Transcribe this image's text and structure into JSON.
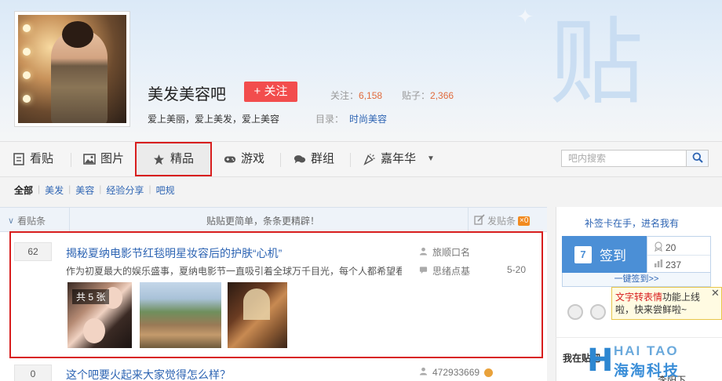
{
  "header": {
    "forum_name": "美发美容吧",
    "follow_label": "+ 关注",
    "stats": {
      "follow_label": "关注：",
      "follow_value": "6,158",
      "posts_label": "贴子：",
      "posts_value": "2,366"
    },
    "slogan": "爱上美丽，爱上美发，爱上美容",
    "directory_label": "目录：",
    "directory_value": "时尚美容"
  },
  "nav": {
    "items": [
      {
        "label": "看贴",
        "icon": "document-icon"
      },
      {
        "label": "图片",
        "icon": "image-icon"
      },
      {
        "label": "精品",
        "icon": "star-icon"
      },
      {
        "label": "游戏",
        "icon": "gamepad-icon"
      },
      {
        "label": "群组",
        "icon": "chat-group-icon"
      },
      {
        "label": "嘉年华",
        "icon": "party-icon"
      }
    ],
    "search_placeholder": "吧内搜索"
  },
  "subnav": {
    "items": [
      "全部",
      "美发",
      "美容",
      "经验分享",
      "吧规"
    ]
  },
  "list_header": {
    "left": "看贴条",
    "center": "贴贴更简单，条条更精辟！",
    "right": "发贴条",
    "badge": "×0"
  },
  "threads": [
    {
      "replies": "62",
      "title": "揭秘夏纳电影节红毯明星妆容后的护肤“心机”",
      "abstract": "作为初夏最大的娱乐盛事，夏纳电影节一直吸引着全球万千目光，每个人都希望看…",
      "author": "旅顺口名",
      "last_reply": "思绪点基",
      "time": "5-20",
      "image_count": "共 5 张"
    },
    {
      "replies": "0",
      "title": "这个吧要火起来大家觉得怎么样？",
      "author": "472933669"
    }
  ],
  "sidebar": {
    "promo": "补签卡在手，进名我有",
    "sign_label": "签到",
    "sign_day": "7",
    "sign_count": "20",
    "sign_rank": "237",
    "sign_link": "一键签到>>",
    "tooltip_highlight": "文字转表情",
    "tooltip_text": "功能上线啦，快来尝鲜啦~",
    "section_title": "我在贴吧",
    "user_name": "李阳下"
  },
  "watermark": {
    "letter": "H",
    "en": "HAI TAO",
    "cn": "海淘科技"
  },
  "colors": {
    "link": "#2d64b3",
    "follow_btn": "#f24d4d",
    "highlight_border": "#d81e1e",
    "sign_btn": "#4b8fd6"
  }
}
